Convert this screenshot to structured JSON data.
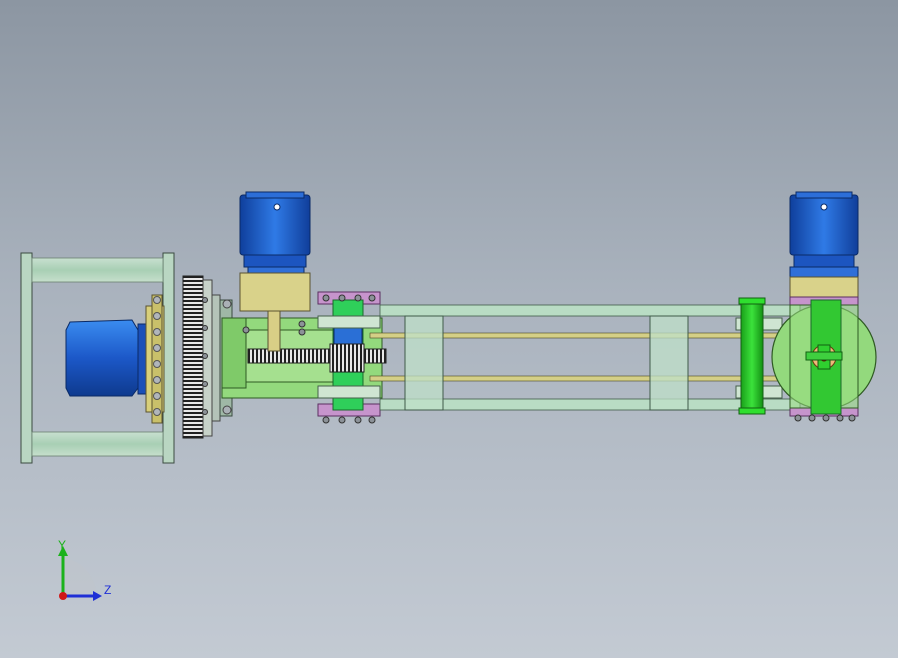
{
  "viewport": {
    "background_top": "#8c96a2",
    "background_bottom": "#c3cad3"
  },
  "triad": {
    "y_label": "Y",
    "z_label": "Z",
    "y_color": "#1bb21b",
    "z_color": "#1f2fd6",
    "x_color": "#d01818"
  },
  "colors": {
    "motor_blue": "#1f5fd0",
    "frame_green": "#8fd27a",
    "frame_lightgreen": "#b8dcc0",
    "gearbox_tan": "#d8d08a",
    "link_pink": "#c88ad0",
    "gear_dark": "#2a2a2a",
    "bolt_gray": "#9aa0a6",
    "shaft_green": "#2fcf2f"
  },
  "icons": {
    "triad": "coordinate-triad-icon"
  }
}
